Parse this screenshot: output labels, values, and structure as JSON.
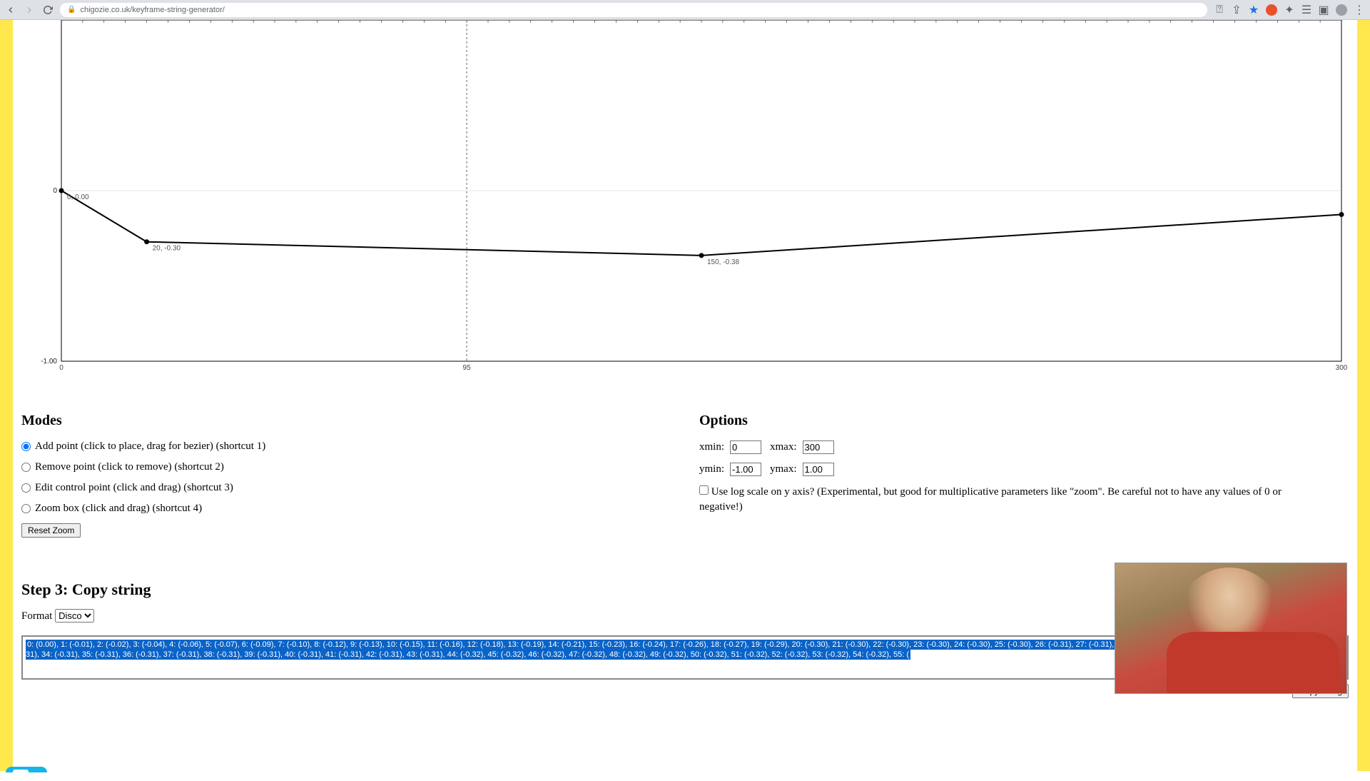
{
  "browser": {
    "url": "chigozie.co.uk/keyframe-string-generator/"
  },
  "chart_data": {
    "type": "line",
    "x": [
      0,
      20,
      150,
      300
    ],
    "y": [
      0.0,
      -0.3,
      -0.38,
      -0.14
    ],
    "xlim": [
      0,
      300
    ],
    "ylim": [
      -1.0,
      1.0
    ],
    "xticks": [
      0,
      95,
      300
    ],
    "yticks": [
      -1.0,
      0
    ],
    "point_labels": [
      {
        "x": 0,
        "y": 0.0,
        "text": "0, 0.00"
      },
      {
        "x": 20,
        "y": -0.3,
        "text": "20, -0.30"
      },
      {
        "x": 150,
        "y": -0.38,
        "text": "150, -0.38"
      }
    ],
    "cursor_x": 95
  },
  "modes": {
    "heading": "Modes",
    "items": [
      {
        "label": "Add point (click to place, drag for bezier) (shortcut 1)",
        "checked": true
      },
      {
        "label": "Remove point (click to remove) (shortcut 2)",
        "checked": false
      },
      {
        "label": "Edit control point (click and drag) (shortcut 3)",
        "checked": false
      },
      {
        "label": "Zoom box (click and drag) (shortcut 4)",
        "checked": false
      }
    ],
    "reset_label": "Reset Zoom"
  },
  "options": {
    "heading": "Options",
    "xmin_label": "xmin:",
    "xmin": "0",
    "xmax_label": "xmax:",
    "xmax": "300",
    "ymin_label": "ymin:",
    "ymin": "-1.00",
    "ymax_label": "ymax:",
    "ymax": "1.00",
    "log_label": "Use log scale on y axis? (Experimental, but good for multiplicative parameters like \"zoom\". Be careful not to have any values of 0 or negative!)"
  },
  "step3": {
    "heading": "Step 3: Copy string",
    "format_label": "Format",
    "format_value": "Disco",
    "output": "0: (0.00), 1: (-0.01), 2: (-0.02), 3: (-0.04), 4: (-0.06), 5: (-0.07), 6: (-0.09), 7: (-0.10), 8: (-0.12), 9: (-0.13), 10: (-0.15), 11: (-0.16), 12: (-0.18), 13: (-0.19), 14: (-0.21), 15: (-0.23), 16: (-0.24), 17: (-0.26), 18: (-0.27), 19: (-0.29), 20: (-0.30), 21: (-0.30), 22: (-0.30), 23: (-0.30), 24: (-0.30), 25: (-0.30), 26: (-0.31), 27: (-0.31), 28: (-0.31), 29: (-0.31), 30: (-0.31), 31: (-0.31), 32: (-0.31), 33: (-0.31), 34: (-0.31), 35: (-0.31), 36: (-0.31), 37: (-0.31), 38: (-0.31), 39: (-0.31), 40: (-0.31), 41: (-0.31), 42: (-0.31), 43: (-0.31), 44: (-0.32), 45: (-0.32), 46: (-0.32), 47: (-0.32), 48: (-0.32), 49: (-0.32), 50: (-0.32), 51: (-0.32), 52: (-0.32), 53: (-0.32), 54: (-0.32), 55: (",
    "copy_label": "Copy string"
  }
}
